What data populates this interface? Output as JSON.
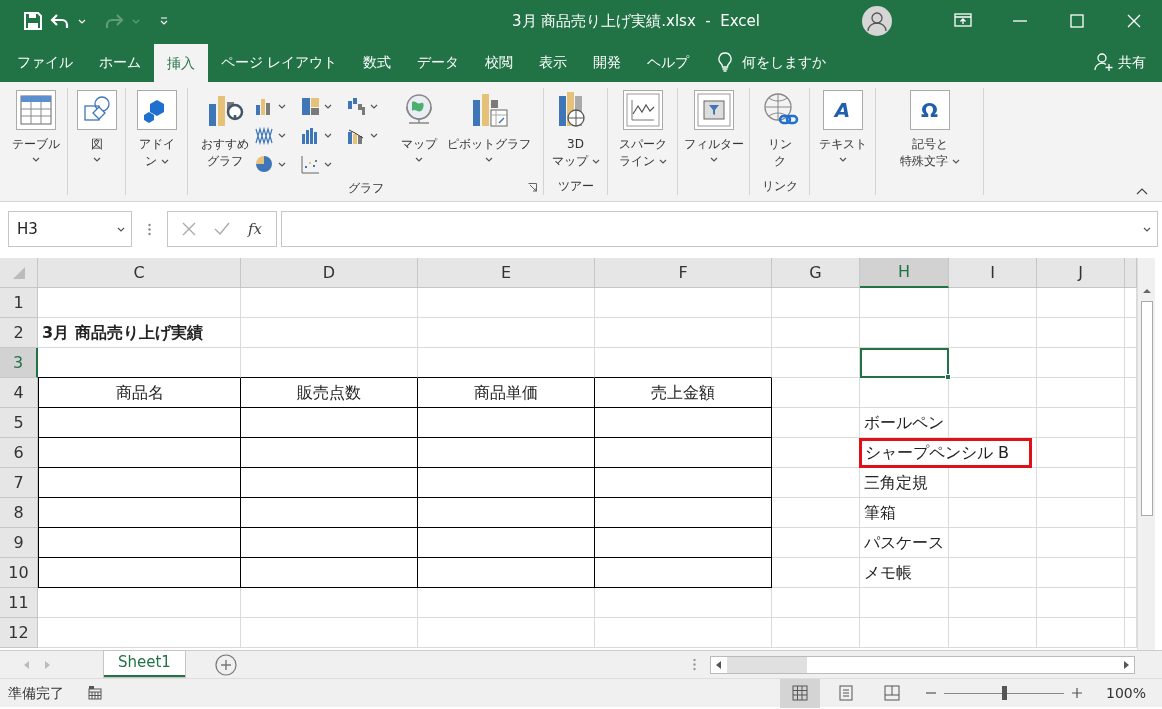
{
  "title_bar": {
    "title": "3月 商品売り上げ実績.xlsx  -  Excel",
    "redo_disabled": true
  },
  "ribbon_tabs": [
    {
      "label": "ファイル",
      "selected": false
    },
    {
      "label": "ホーム",
      "selected": false
    },
    {
      "label": "挿入",
      "selected": true
    },
    {
      "label": "ページ レイアウト",
      "selected": false
    },
    {
      "label": "数式",
      "selected": false
    },
    {
      "label": "データ",
      "selected": false
    },
    {
      "label": "校閲",
      "selected": false
    },
    {
      "label": "表示",
      "selected": false
    },
    {
      "label": "開発",
      "selected": false
    },
    {
      "label": "ヘルプ",
      "selected": false
    }
  ],
  "tell_me": {
    "placeholder": "何をしますか"
  },
  "share": "共有",
  "ribbon_groups": [
    {
      "buttons": [
        {
          "lines": [
            "テーブル"
          ],
          "dropdown": true
        }
      ]
    },
    {
      "buttons": [
        {
          "lines": [
            "図"
          ],
          "dropdown": true
        }
      ]
    },
    {
      "buttons": [
        {
          "lines": [
            "アドイ",
            "ン"
          ],
          "dropdown": true
        }
      ]
    },
    {
      "label": "グラフ",
      "launcher": true,
      "buttons": [
        {
          "lines": [
            "おすすめ",
            "グラフ"
          ],
          "dropdown": false
        },
        {
          "kind": "small-grid"
        },
        {
          "lines": [
            "マップ"
          ],
          "dropdown": true
        },
        {
          "lines": [
            "ピボットグラフ"
          ],
          "dropdown": true
        }
      ]
    },
    {
      "label": "ツアー",
      "buttons": [
        {
          "lines": [
            "3D",
            "マップ"
          ],
          "dropdown": true
        }
      ]
    },
    {
      "buttons": [
        {
          "lines": [
            "スパーク",
            "ライン"
          ],
          "dropdown": true
        }
      ]
    },
    {
      "buttons": [
        {
          "lines": [
            "フィルター"
          ],
          "dropdown": true
        }
      ]
    },
    {
      "label": "リンク",
      "buttons": [
        {
          "lines": [
            "リン",
            "ク"
          ],
          "dropdown": false
        }
      ]
    },
    {
      "buttons": [
        {
          "lines": [
            "テキスト"
          ],
          "dropdown": true,
          "glyph": "A"
        }
      ]
    },
    {
      "buttons": [
        {
          "lines": [
            "記号と",
            "特殊文字"
          ],
          "dropdown": true,
          "glyph": "Ω"
        }
      ]
    }
  ],
  "name_box": "H3",
  "fx_label": "fx",
  "columns": [
    {
      "label": "C",
      "selected": false,
      "in_table": true
    },
    {
      "label": "D",
      "selected": false,
      "in_table": true
    },
    {
      "label": "E",
      "selected": false,
      "in_table": true
    },
    {
      "label": "F",
      "selected": false,
      "in_table": true
    },
    {
      "label": "G",
      "selected": false,
      "in_table": false
    },
    {
      "label": "H",
      "selected": true,
      "in_table": false
    },
    {
      "label": "I",
      "selected": false,
      "in_table": false
    },
    {
      "label": "J",
      "selected": false,
      "in_table": false
    }
  ],
  "rows": [
    {
      "label": "1",
      "selected": false,
      "in_table": false
    },
    {
      "label": "2",
      "selected": false,
      "in_table": false,
      "cells": [
        {
          "text": "3月 商品売り上げ実績",
          "kind": "title"
        },
        null,
        null,
        null,
        null,
        null,
        null,
        null
      ]
    },
    {
      "label": "3",
      "selected": true,
      "in_table": false
    },
    {
      "label": "4",
      "selected": false,
      "in_table": true,
      "cells": [
        {
          "text": "商品名",
          "kind": "header"
        },
        {
          "text": "販売点数",
          "kind": "header"
        },
        {
          "text": "商品単価",
          "kind": "header"
        },
        {
          "text": "売上金額",
          "kind": "header"
        },
        null,
        null,
        null,
        null
      ]
    },
    {
      "label": "5",
      "selected": false,
      "in_table": true,
      "cells": [
        null,
        null,
        null,
        null,
        null,
        {
          "text": "ボールペン",
          "kind": "plain",
          "marked": false
        },
        null,
        null
      ]
    },
    {
      "label": "6",
      "selected": false,
      "in_table": true,
      "cells": [
        null,
        null,
        null,
        null,
        null,
        {
          "text": "シャープペンシル B",
          "kind": "plain",
          "marked": true
        },
        null,
        null
      ]
    },
    {
      "label": "7",
      "selected": false,
      "in_table": true,
      "cells": [
        null,
        null,
        null,
        null,
        null,
        {
          "text": "三角定規",
          "kind": "plain",
          "marked": false
        },
        null,
        null
      ]
    },
    {
      "label": "8",
      "selected": false,
      "in_table": true,
      "cells": [
        null,
        null,
        null,
        null,
        null,
        {
          "text": "筆箱",
          "kind": "plain",
          "marked": false
        },
        null,
        null
      ]
    },
    {
      "label": "9",
      "selected": false,
      "in_table": true,
      "cells": [
        null,
        null,
        null,
        null,
        null,
        {
          "text": "パスケース",
          "kind": "plain",
          "marked": false
        },
        null,
        null
      ]
    },
    {
      "label": "10",
      "selected": false,
      "in_table": true,
      "cells": [
        null,
        null,
        null,
        null,
        null,
        {
          "text": "メモ帳",
          "kind": "plain",
          "marked": false
        },
        null,
        null
      ]
    },
    {
      "label": "11",
      "selected": false,
      "in_table": false
    },
    {
      "label": "12",
      "selected": false,
      "in_table": false
    }
  ],
  "sheet_tabs": [
    {
      "label": "Sheet1",
      "selected": true
    }
  ],
  "status_bar": {
    "status": "準備完了",
    "views": [
      {
        "kind": "normal",
        "selected": true
      },
      {
        "kind": "page",
        "selected": false
      },
      {
        "kind": "break",
        "selected": false
      }
    ],
    "zoom": {
      "level": 0.5,
      "reading": "100%"
    }
  }
}
